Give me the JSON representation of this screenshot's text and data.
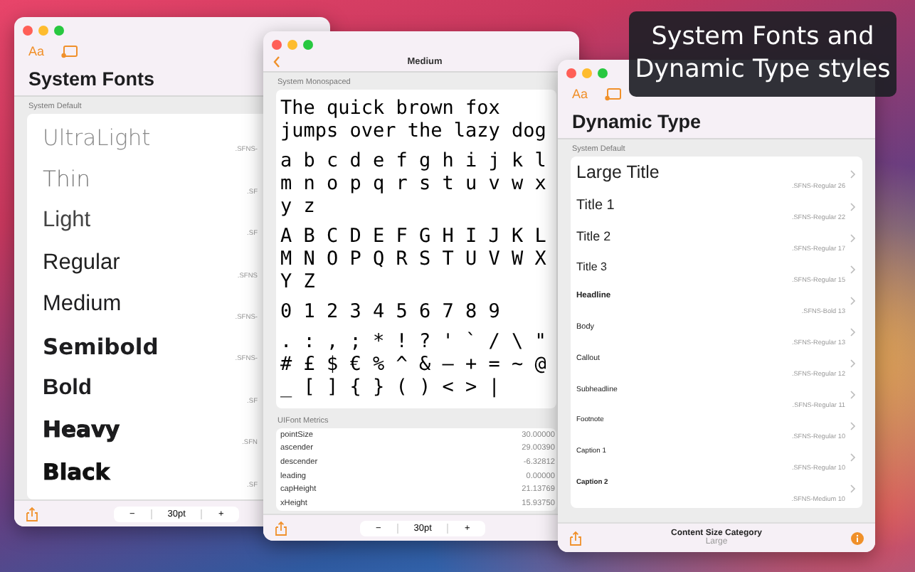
{
  "system_fonts_window": {
    "toolbar_label": "Aa",
    "title": "System Fonts",
    "section": "System Default",
    "rows": [
      {
        "name": "UltraLight",
        "font_name": ".SFNS-"
      },
      {
        "name": "Thin",
        "font_name": ".SF"
      },
      {
        "name": "Light",
        "font_name": ".SF"
      },
      {
        "name": "Regular",
        "font_name": ".SFNS"
      },
      {
        "name": "Medium",
        "font_name": ".SFNS-"
      },
      {
        "name": "Semibold",
        "font_name": ".SFNS-"
      },
      {
        "name": "Bold",
        "font_name": ".SF"
      },
      {
        "name": "Heavy",
        "font_name": ".SFN"
      },
      {
        "name": "Black",
        "font_name": ".SF"
      }
    ],
    "stepper": {
      "minus": "−",
      "value": "30pt",
      "plus": "+"
    }
  },
  "monospaced_window": {
    "title": "Medium",
    "section": "System Monospaced",
    "sample_blocks": [
      "The quick brown fox jumps over the lazy dog",
      "a b c d e f g h i j k l m n o p q r s t u v w x y z",
      "A B C D E F G H I J K L M N O P Q R S T U V W X Y Z",
      "0 1 2 3 4 5 6 7 8 9",
      ". : , ; * ! ? ' ` / \\ \" # £ $ € % ^ & – + = ~ @ _ [ ] { } ( ) < > |"
    ],
    "metrics_section": "UIFont Metrics",
    "metrics": [
      {
        "name": "pointSize",
        "value": "30.00000"
      },
      {
        "name": "ascender",
        "value": "29.00390"
      },
      {
        "name": "descender",
        "value": "-6.32812"
      },
      {
        "name": "leading",
        "value": "0.00000"
      },
      {
        "name": "capHeight",
        "value": "21.13769"
      },
      {
        "name": "xHeight",
        "value": "15.93750"
      }
    ],
    "stepper": {
      "minus": "−",
      "value": "30pt",
      "plus": "+"
    }
  },
  "dynamic_type_window": {
    "toolbar_label": "Aa",
    "title": "Dynamic Type",
    "section": "System Default",
    "rows": [
      {
        "name": "Large Title",
        "font_name": ".SFNS-Regular 26"
      },
      {
        "name": "Title 1",
        "font_name": ".SFNS-Regular 22"
      },
      {
        "name": "Title 2",
        "font_name": ".SFNS-Regular 17"
      },
      {
        "name": "Title 3",
        "font_name": ".SFNS-Regular 15"
      },
      {
        "name": "Headline",
        "font_name": ".SFNS-Bold 13"
      },
      {
        "name": "Body",
        "font_name": ".SFNS-Regular 13"
      },
      {
        "name": "Callout",
        "font_name": ".SFNS-Regular 12"
      },
      {
        "name": "Subheadline",
        "font_name": ".SFNS-Regular 11"
      },
      {
        "name": "Footnote",
        "font_name": ".SFNS-Regular 10"
      },
      {
        "name": "Caption 1",
        "font_name": ".SFNS-Regular 10"
      },
      {
        "name": "Caption 2",
        "font_name": ".SFNS-Medium 10"
      }
    ],
    "category_label": "Content Size Category",
    "category_value": "Large"
  },
  "caption": {
    "lines": [
      "System Fonts and",
      "Dynamic Type styles"
    ]
  }
}
